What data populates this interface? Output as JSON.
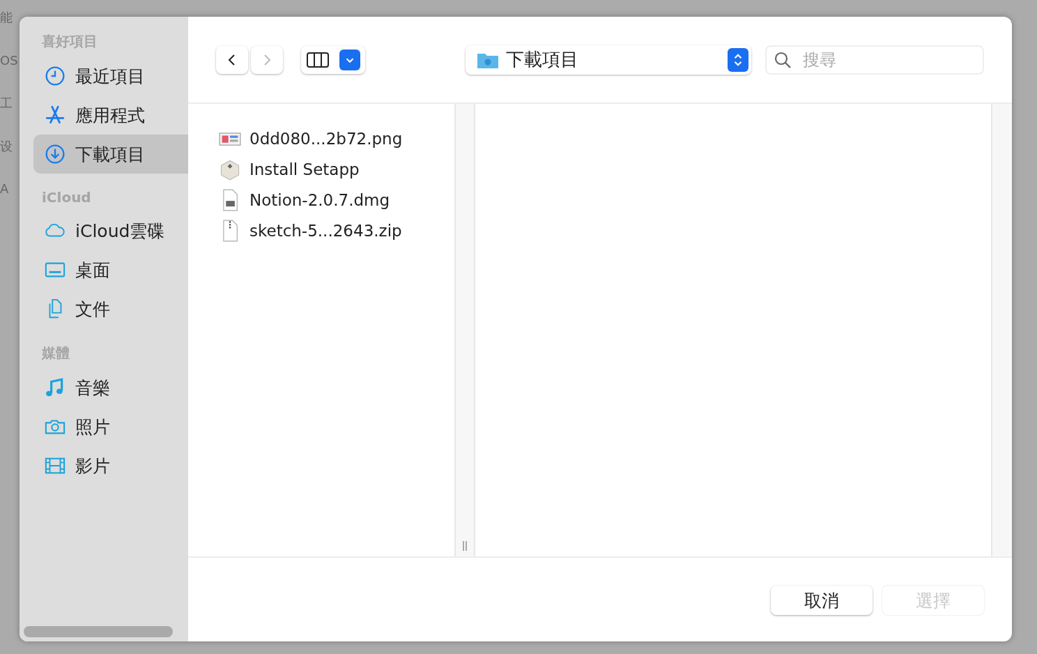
{
  "backdrop": {
    "fragments": [
      "能",
      "OS",
      "工",
      "设",
      "A"
    ]
  },
  "sidebar": {
    "sections": [
      {
        "title": "喜好項目",
        "items": [
          {
            "label": "最近項目",
            "kind": "clock",
            "selected": false
          },
          {
            "label": "應用程式",
            "kind": "apps",
            "selected": false
          },
          {
            "label": "下載項目",
            "kind": "download",
            "selected": true
          }
        ]
      },
      {
        "title": "iCloud",
        "items": [
          {
            "label": "iCloud雲碟",
            "kind": "cloud",
            "selected": false
          },
          {
            "label": "桌面",
            "kind": "desktop",
            "selected": false
          },
          {
            "label": "文件",
            "kind": "documents",
            "selected": false
          }
        ]
      },
      {
        "title": "媒體",
        "items": [
          {
            "label": "音樂",
            "kind": "music",
            "selected": false
          },
          {
            "label": "照片",
            "kind": "camera",
            "selected": false
          },
          {
            "label": "影片",
            "kind": "film",
            "selected": false
          }
        ]
      }
    ]
  },
  "toolbar": {
    "back_disabled": false,
    "forward_disabled": true,
    "location": "下載項目",
    "search": {
      "placeholder": "搜尋"
    }
  },
  "files": [
    {
      "name": "0dd080...2b72.png",
      "kind": "image"
    },
    {
      "name": "Install Setapp",
      "kind": "package"
    },
    {
      "name": "Notion-2.0.7.dmg",
      "kind": "disk"
    },
    {
      "name": "sketch-5...2643.zip",
      "kind": "zip"
    }
  ],
  "buttons": [
    {
      "label": "取消",
      "disabled": false
    },
    {
      "label": "選擇",
      "disabled": true
    }
  ]
}
